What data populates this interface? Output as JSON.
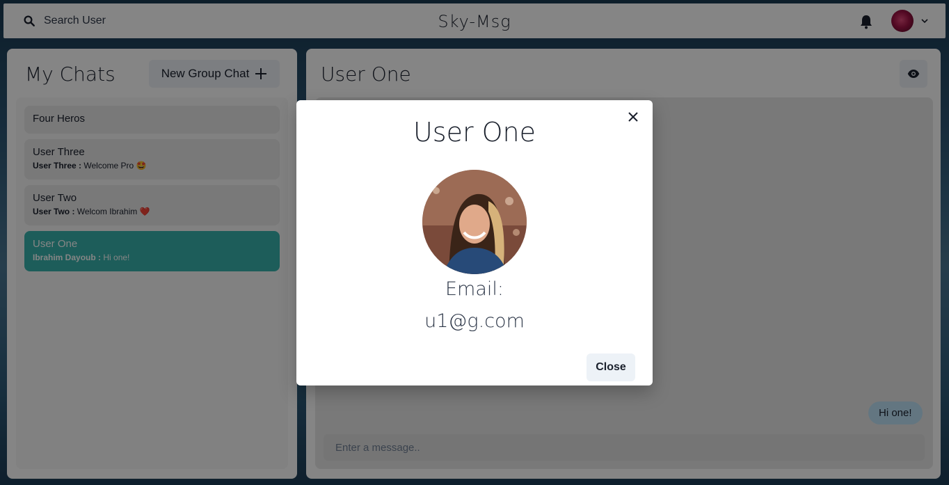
{
  "topbar": {
    "search_label": "Search User",
    "brand": "Sky-Msg"
  },
  "chats_panel": {
    "title": "My Chats",
    "new_group_label": "New Group Chat",
    "items": [
      {
        "name": "Four Heros"
      },
      {
        "name": "User Three",
        "sender": "User Three :",
        "message": "Welcome Pro",
        "emoji": "🤩"
      },
      {
        "name": "User Two",
        "sender": "User Two :",
        "message": "Welcom Ibrahim",
        "emoji": "❤️"
      },
      {
        "name": "User One",
        "sender": "Ibrahim Dayoub :",
        "message": "Hi one!"
      }
    ]
  },
  "chat_panel": {
    "title": "User One",
    "messages": [
      {
        "text": "Hi one!"
      }
    ],
    "input_placeholder": "Enter a message.."
  },
  "modal": {
    "title": "User One",
    "email_label": "Email:",
    "email": "u1@g.com",
    "close_label": "Close"
  },
  "colors": {
    "accent": "#38b2ac",
    "bubble": "#bee3f8",
    "button_bg": "#edf2f7"
  },
  "icons": [
    "search-icon",
    "bell-icon",
    "chevron-down-icon",
    "plus-icon",
    "eye-icon",
    "close-icon"
  ]
}
